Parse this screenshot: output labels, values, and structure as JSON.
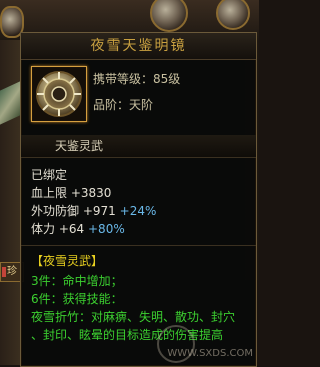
{
  "item": {
    "name": "夜雪天鉴明镜",
    "carry_level": "携带等级：85级",
    "grade": "品阶：天阶",
    "set_name": "天鉴灵武",
    "bound": "已绑定",
    "stats": [
      {
        "name": "血上限",
        "value": "+3830",
        "bonus": ""
      },
      {
        "name": "外功防御",
        "value": "+971",
        "bonus": "+24%"
      },
      {
        "name": "体力",
        "value": "+64",
        "bonus": "+80%"
      }
    ],
    "set_bonus": {
      "title": "【夜雪灵武】",
      "pc3": "3件：命中增加；",
      "pc6": "6件：获得技能：",
      "skill_line1": "夜雪折竹：对麻痹、失明、散功、封穴",
      "skill_line2": "、封印、眩晕的目标造成的伤害提高"
    }
  },
  "ui": {
    "side_tab": "珍",
    "watermark": "WWW.SXDS.COM"
  },
  "colors": {
    "title": "#c8a040",
    "stat_white": "#e4e0d4",
    "stat_bonus": "#6ab8e8",
    "set_green": "#3cd030",
    "set_title_yellow": "#e8d020",
    "icon_border": "#d6a040"
  },
  "icons": {
    "item_icon": "mirror-gear-icon"
  }
}
